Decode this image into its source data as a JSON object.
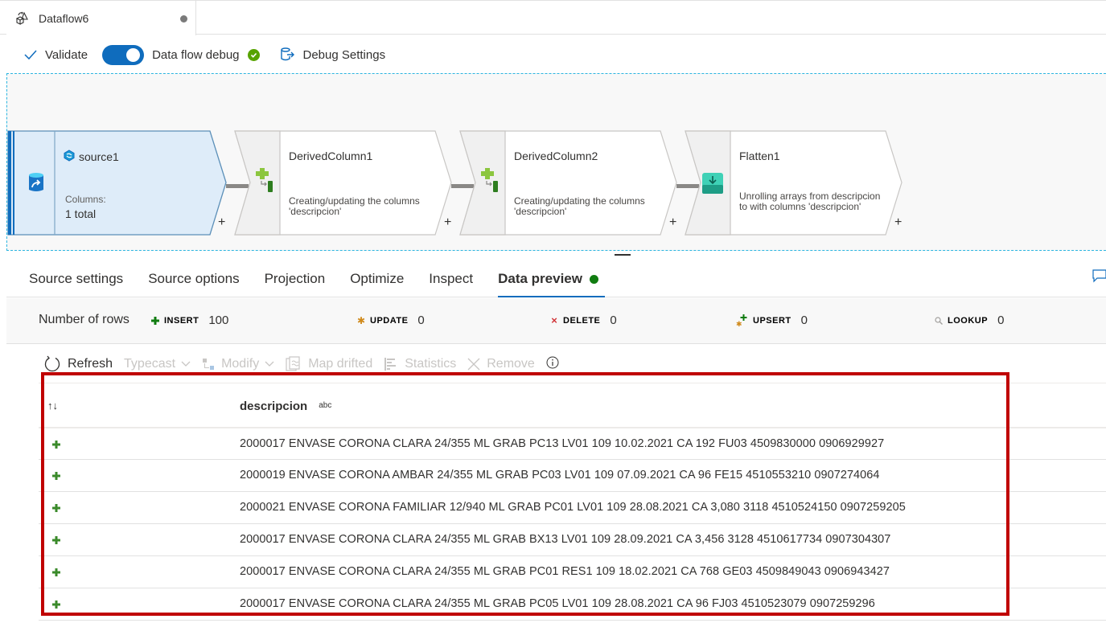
{
  "tab": {
    "title": "Dataflow6",
    "icon": "dataflow-icon",
    "unsaved": true
  },
  "commands": {
    "validate": "Validate",
    "debug_label": "Data flow debug",
    "debug_on": true,
    "debug_status": "ok",
    "debug_settings": "Debug Settings"
  },
  "nodes": [
    {
      "type": "source",
      "name": "source1",
      "columns_label": "Columns:",
      "columns_value": "1 total",
      "icon": "database-source-icon"
    },
    {
      "type": "derived",
      "name": "DerivedColumn1",
      "description": "Creating/updating the columns 'descripcion'",
      "icon": "derived-column-icon"
    },
    {
      "type": "derived",
      "name": "DerivedColumn2",
      "description": "Creating/updating the columns 'descripcion'",
      "icon": "derived-column-icon"
    },
    {
      "type": "flatten",
      "name": "Flatten1",
      "description": "Unrolling arrays from descripcion to  with columns 'descripcion'",
      "icon": "flatten-icon"
    }
  ],
  "settings_tabs": [
    {
      "label": "Source settings",
      "active": false
    },
    {
      "label": "Source options",
      "active": false
    },
    {
      "label": "Projection",
      "active": false
    },
    {
      "label": "Optimize",
      "active": false
    },
    {
      "label": "Inspect",
      "active": false
    },
    {
      "label": "Data preview",
      "active": true
    }
  ],
  "row_counts": {
    "label": "Number of rows",
    "items": [
      {
        "kind": "INSERT",
        "value": "100",
        "icon": "insert-plus-icon",
        "color": "#107c10"
      },
      {
        "kind": "UPDATE",
        "value": "0",
        "icon": "update-asterisk-icon",
        "color": "#d08a1c"
      },
      {
        "kind": "DELETE",
        "value": "0",
        "icon": "delete-x-icon",
        "color": "#d13438"
      },
      {
        "kind": "UPSERT",
        "value": "0",
        "icon": "upsert-icon",
        "color": "#107c10"
      },
      {
        "kind": "LOOKUP",
        "value": "0",
        "icon": "lookup-search-icon",
        "color": "#a19f9d"
      }
    ]
  },
  "preview_toolbar": {
    "refresh": "Refresh",
    "typecast": "Typecast",
    "modify": "Modify",
    "map_drifted": "Map drifted",
    "statistics": "Statistics",
    "remove": "Remove"
  },
  "grid": {
    "sort_glyph": "↑↓",
    "column": "descripcion",
    "column_type": "abc",
    "rows": [
      "2000017 ENVASE CORONA CLARA 24/355 ML GRAB PC13 LV01 109 10.02.2021 CA 192 FU03 4509830000 0906929927",
      "2000019 ENVASE CORONA AMBAR 24/355 ML GRAB PC03 LV01 109 07.09.2021 CA 96 FE15 4510553210 0907274064",
      "2000021 ENVASE CORONA FAMILIAR 12/940 ML GRAB PC01 LV01 109 28.08.2021 CA 3,080 3118 4510524150 0907259205",
      "2000017 ENVASE CORONA CLARA 24/355 ML GRAB BX13 LV01 109 28.09.2021 CA 3,456 3128 4510617734 0907304307",
      "2000017 ENVASE CORONA CLARA 24/355 ML GRAB PC01 RES1 109 18.02.2021 CA 768 GE03 4509849043 0906943427",
      "2000017 ENVASE CORONA CLARA 24/355 ML GRAB PC05 LV01 109 28.08.2021 CA 96 FJ03 4510523079 0907259296"
    ]
  },
  "colors": {
    "accent": "#0f6cbd",
    "highlight_box": "#c00000",
    "canvas_border": "#2bb5e0",
    "source_fill": "#deecf9",
    "success": "#107c10"
  }
}
